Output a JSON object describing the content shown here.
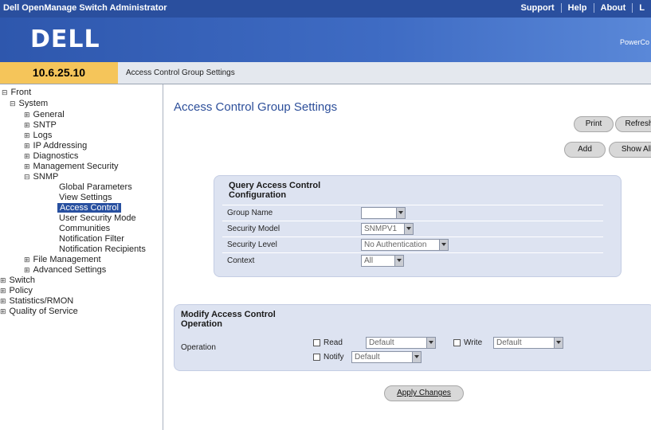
{
  "app": {
    "title": "Dell OpenManage Switch Administrator",
    "links": [
      "Support",
      "Help",
      "About",
      "L"
    ],
    "brand": "DELL",
    "brand_right": "PowerCo"
  },
  "address": {
    "ip": "10.6.25.10",
    "breadcrumb": "Access Control Group Settings"
  },
  "sidebar": {
    "items": [
      {
        "label": "Front"
      },
      {
        "label": "System"
      },
      {
        "label": "General"
      },
      {
        "label": "SNTP"
      },
      {
        "label": "Logs"
      },
      {
        "label": "IP Addressing"
      },
      {
        "label": "Diagnostics"
      },
      {
        "label": "Management Security"
      },
      {
        "label": "SNMP"
      },
      {
        "label": "Global Parameters"
      },
      {
        "label": "View Settings"
      },
      {
        "label": "Access Control"
      },
      {
        "label": "User Security Mode"
      },
      {
        "label": "Communities"
      },
      {
        "label": "Notification Filter"
      },
      {
        "label": "Notification Recipients"
      },
      {
        "label": "File Management"
      },
      {
        "label": "Advanced Settings"
      },
      {
        "label": "Switch"
      },
      {
        "label": "Policy"
      },
      {
        "label": "Statistics/RMON"
      },
      {
        "label": "Quality of Service"
      }
    ]
  },
  "main": {
    "title": "Access Control Group Settings",
    "buttons": {
      "print": "Print",
      "refresh": "Refresh",
      "add": "Add",
      "show_all": "Show All"
    },
    "query": {
      "heading": "Query Access Control Configuration",
      "fields": [
        {
          "label": "Group Name",
          "value": ""
        },
        {
          "label": "Security Model",
          "value": "SNMPV1"
        },
        {
          "label": "Security Level",
          "value": "No Authentication"
        },
        {
          "label": "Context",
          "value": "All"
        }
      ]
    },
    "modify": {
      "heading": "Modify Access Control Operation",
      "operation_label": "Operation",
      "read_label": "Read",
      "read_value": "Default",
      "write_label": "Write",
      "write_value": "Default",
      "notify_label": "Notify",
      "notify_value": "Default"
    },
    "apply": "Apply Changes"
  }
}
